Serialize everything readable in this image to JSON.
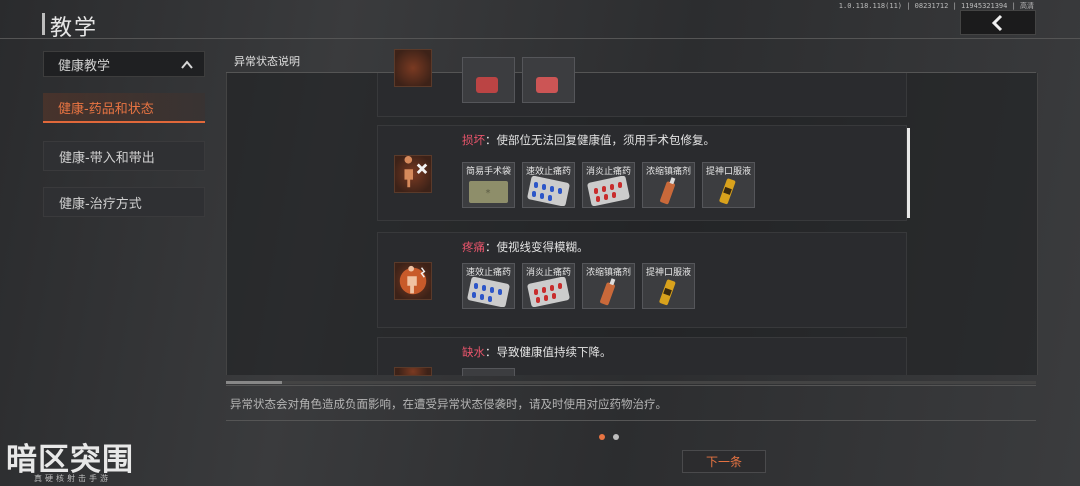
{
  "header": {
    "title": "教学",
    "version": "1.0.118.118(11) | 08231712 | 11945321394 | 高清"
  },
  "sidebar": {
    "header": "健康教学",
    "items": [
      {
        "label": "健康-药品和状态"
      },
      {
        "label": "健康-带入和带出"
      },
      {
        "label": "健康-治疗方式"
      }
    ]
  },
  "panel": {
    "title": "异常状态说明",
    "cards": [
      {
        "name": "损坏",
        "desc": "：使部位无法回复健康值，须用手术包修复。",
        "items": [
          "简易手术袋",
          "速效止痛药",
          "消炎止痛药",
          "浓缩镇痛剂",
          "提神口服液"
        ]
      },
      {
        "name": "疼痛",
        "desc": "：使视线变得模糊。",
        "items": [
          "速效止痛药",
          "消炎止痛药",
          "浓缩镇痛剂",
          "提神口服液"
        ]
      },
      {
        "name": "缺水",
        "desc": "：导致健康值持续下降。",
        "items": []
      }
    ],
    "note": "异常状态会对角色造成负面影响，在遭受异常状态侵袭时，请及时使用对应药物治疗。"
  },
  "pagination": {
    "current": 1,
    "total": 2
  },
  "next_button": "下一条",
  "logo": {
    "main": "暗区突围",
    "sub": "真硬核射击手游"
  },
  "colors": {
    "accent": "#e87442",
    "status_name": "#e8546b"
  }
}
